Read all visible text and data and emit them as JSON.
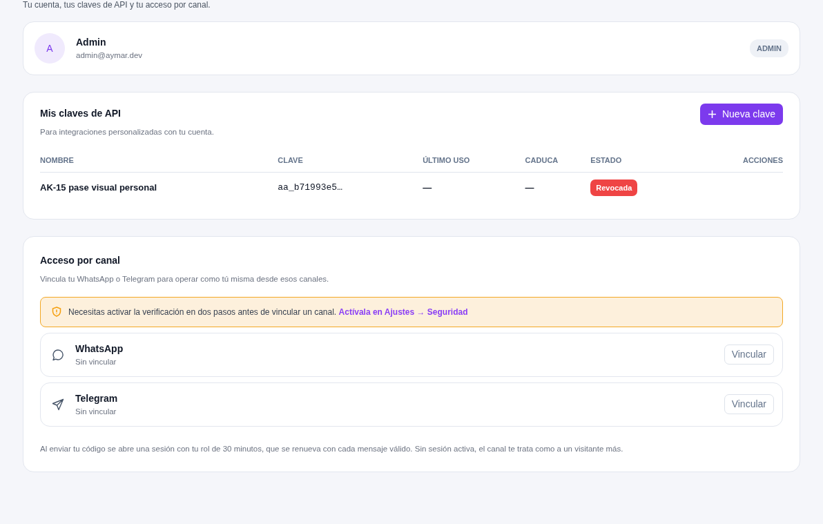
{
  "subtitle": "Tu cuenta, tus claves de API y tu acceso por canal.",
  "profile": {
    "initial": "A",
    "name": "Admin",
    "email": "admin@aymar.dev",
    "role": "ADMIN"
  },
  "api_keys": {
    "title": "Mis claves de API",
    "description": "Para integraciones personalizadas con tu cuenta.",
    "new_button": "Nueva clave",
    "columns": [
      "NOMBRE",
      "CLAVE",
      "ÚLTIMO USO",
      "CADUCA",
      "ESTADO",
      "ACCIONES"
    ],
    "rows": [
      {
        "name": "AK-15 pase visual personal",
        "key": "aa_b71993e5…",
        "last_used": "—",
        "expires": "—",
        "status": {
          "label": "Revocada",
          "kind": "revoked"
        }
      }
    ]
  },
  "channels": {
    "title": "Acceso por canal",
    "description": "Vincula tu WhatsApp o Telegram para operar como tú misma desde esos canales.",
    "alert": {
      "text": "Necesitas activar la verificación en dos pasos antes de vincular un canal.",
      "link": "Actívala en Ajustes → Seguridad"
    },
    "items": [
      {
        "kind": "chat",
        "name": "WhatsApp",
        "status": "Sin vincular",
        "button": "Vincular"
      },
      {
        "kind": "send",
        "name": "Telegram",
        "status": "Sin vincular",
        "button": "Vincular"
      }
    ],
    "footnote": "Al enviar tu código se abre una sesión con tu rol de 30 minutos, que se renueva con cada mensaje válido. Sin sesión activa, el canal te trata como a un visitante más."
  }
}
